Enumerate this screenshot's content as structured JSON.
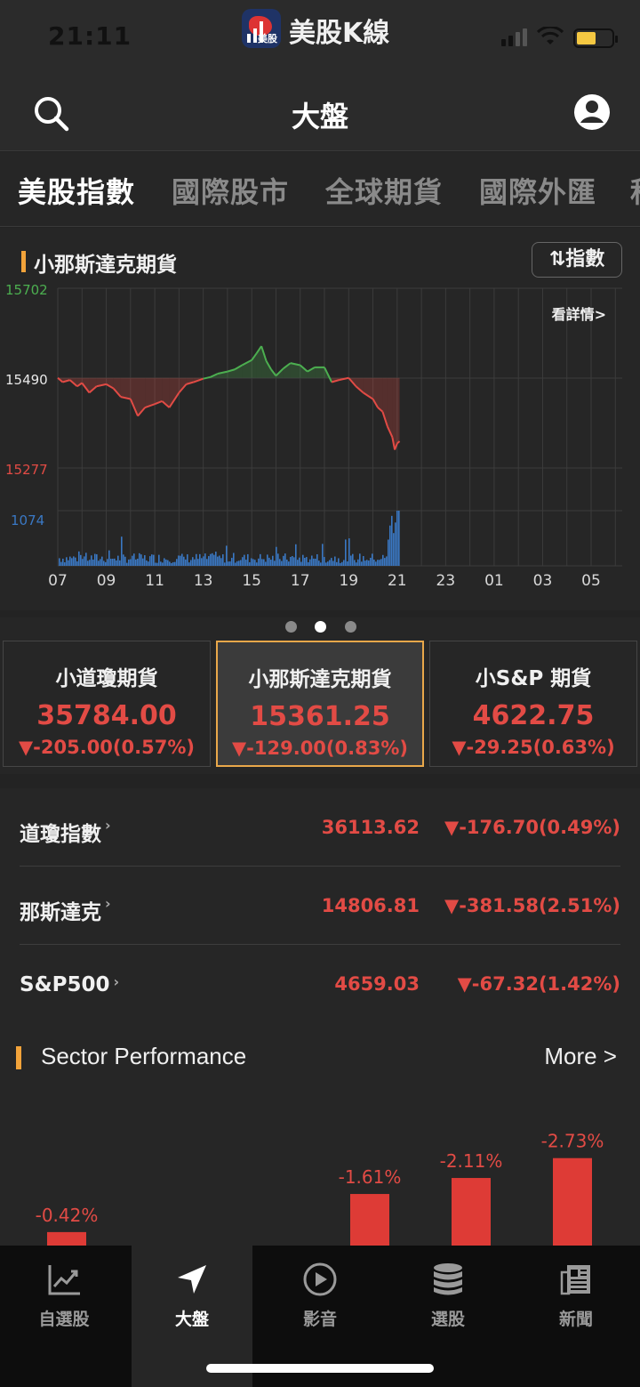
{
  "status": {
    "time": "21:11",
    "app_title": "美股K線",
    "app_badge": "美股"
  },
  "nav": {
    "title": "大盤"
  },
  "tabs": [
    "美股指數",
    "國際股市",
    "全球期貨",
    "國際外匯",
    "科"
  ],
  "chart": {
    "title": "小那斯達克期貨",
    "toggle_label": "⇅指數",
    "detail_link": "看詳情>",
    "colors": {
      "up": "#4caf50",
      "down": "#e24b45",
      "volume": "#3a78c4",
      "accent": "#f2a33a"
    }
  },
  "chart_data": {
    "type": "line",
    "title": "小那斯達克期貨",
    "y_ticks": [
      "15702",
      "15490",
      "15277"
    ],
    "volume_tick": "1074",
    "x_ticks": [
      "07",
      "09",
      "11",
      "13",
      "15",
      "17",
      "19",
      "21",
      "23",
      "01",
      "03",
      "05"
    ],
    "reference": 15490,
    "ylim": [
      15277,
      15702
    ],
    "price_series": {
      "x": [
        7.0,
        7.2,
        7.5,
        7.8,
        8.0,
        8.3,
        8.6,
        9.0,
        9.3,
        9.6,
        10.0,
        10.3,
        10.6,
        11.0,
        11.3,
        11.6,
        12.0,
        12.3,
        12.6,
        13.0,
        13.3,
        13.6,
        14.0,
        14.3,
        14.6,
        15.0,
        15.2,
        15.4,
        15.6,
        15.8,
        16.0,
        16.3,
        16.6,
        17.0,
        17.3,
        17.6,
        18.0,
        18.3,
        18.6,
        19.0,
        19.3,
        19.6,
        20.0,
        20.2,
        20.4,
        20.6,
        20.8,
        20.9,
        21.0,
        21.1
      ],
      "y": [
        15490,
        15480,
        15485,
        15470,
        15478,
        15455,
        15470,
        15475,
        15465,
        15445,
        15440,
        15400,
        15420,
        15428,
        15435,
        15420,
        15455,
        15475,
        15480,
        15488,
        15492,
        15500,
        15505,
        15510,
        15520,
        15532,
        15548,
        15565,
        15530,
        15510,
        15495,
        15512,
        15525,
        15520,
        15505,
        15515,
        15515,
        15480,
        15485,
        15490,
        15470,
        15455,
        15440,
        15420,
        15410,
        15375,
        15350,
        15320,
        15335,
        15340
      ]
    },
    "volume_max": 1074
  },
  "pager": {
    "count": 3,
    "active": 1
  },
  "futures_cards": [
    {
      "name": "小道瓊期貨",
      "price": "35784.00",
      "change": "▼-205.00(0.57%)"
    },
    {
      "name": "小那斯達克期貨",
      "price": "15361.25",
      "change": "▼-129.00(0.83%)"
    },
    {
      "name": "小S&P 期貨",
      "price": "4622.75",
      "change": "▼-29.25(0.63%)"
    }
  ],
  "indices": [
    {
      "name": "道瓊指數",
      "value": "36113.62",
      "change": "▼-176.70(0.49%)"
    },
    {
      "name": "那斯達克",
      "value": "14806.81",
      "change": "▼-381.58(2.51%)"
    },
    {
      "name": "S&P500",
      "value": "4659.03",
      "change": "▼-67.32(1.42%)"
    }
  ],
  "sector": {
    "title": "Sector Performance",
    "more": "More >"
  },
  "sector_chart_data": {
    "type": "bar",
    "values": [
      -0.42,
      -1.61,
      -2.11,
      -2.73
    ],
    "labels": [
      "-0.42%",
      "-1.61%",
      "-2.11%",
      "-2.73%"
    ]
  },
  "tabbar": [
    {
      "label": "自選股",
      "icon": "line-chart-icon"
    },
    {
      "label": "大盤",
      "icon": "navigation-arrow-icon"
    },
    {
      "label": "影音",
      "icon": "play-circle-icon"
    },
    {
      "label": "選股",
      "icon": "database-stack-icon"
    },
    {
      "label": "新聞",
      "icon": "newspaper-icon"
    }
  ]
}
